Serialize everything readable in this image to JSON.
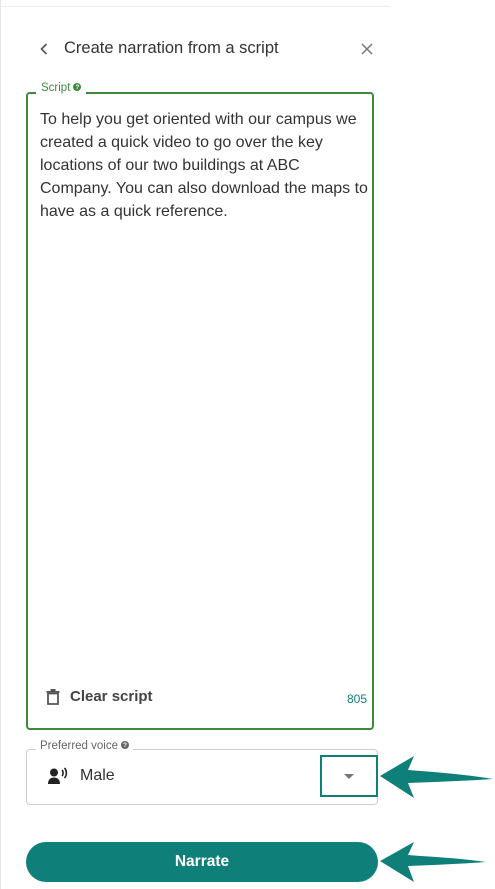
{
  "panel": {
    "title": "Create narration from a script",
    "back_icon": "chevron-left-icon",
    "close_icon": "close-icon"
  },
  "script": {
    "label": "Script",
    "text": "To help you get oriented with our campus we created a quick video to go over the key locations of our two buildings at ABC Company. You can also download the maps to have as a quick reference.",
    "clear_label": "Clear script",
    "char_count": "805"
  },
  "voice": {
    "label": "Preferred voice",
    "selected": "Male",
    "icon": "voice-person-icon"
  },
  "actions": {
    "narrate_label": "Narrate"
  },
  "colors": {
    "accent": "#0f7f7a",
    "field_focus": "#3d8a3d"
  }
}
